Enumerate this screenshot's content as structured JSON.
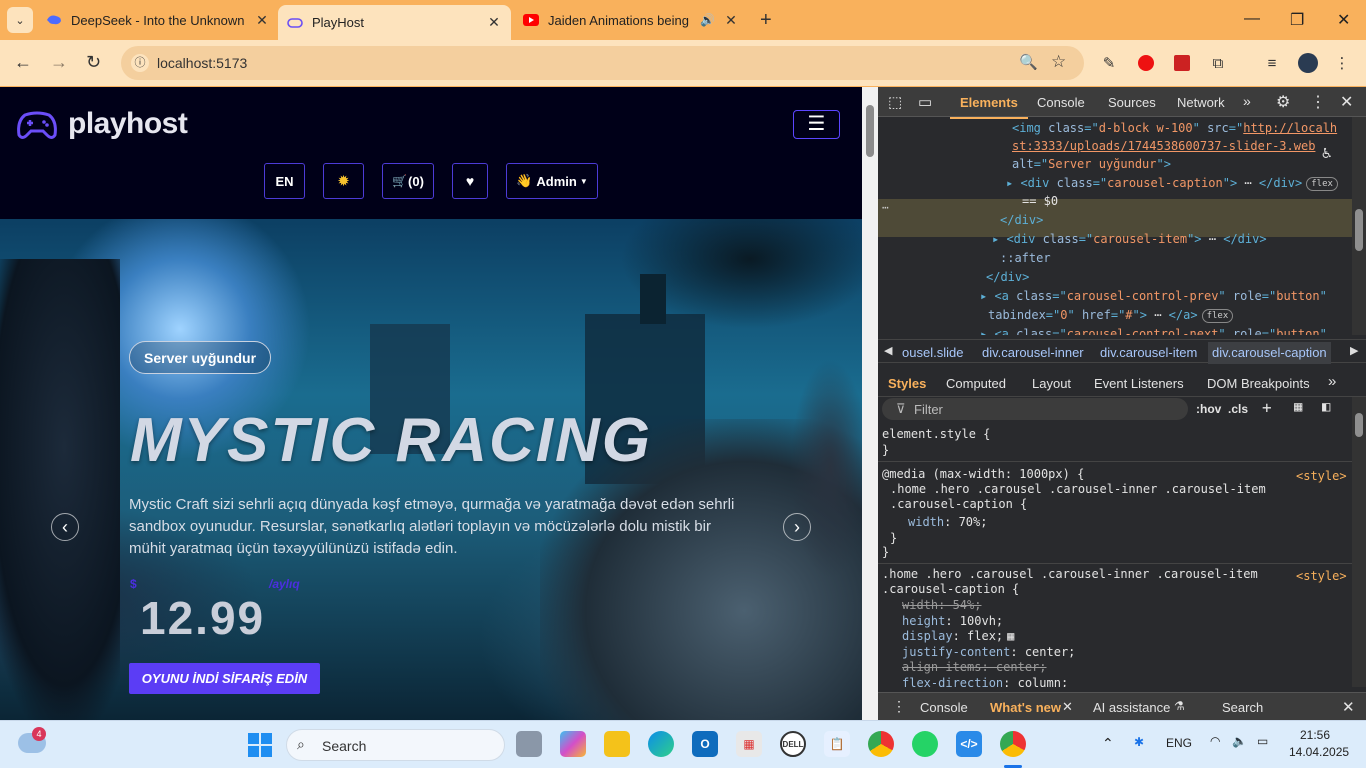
{
  "browser": {
    "tabs": [
      {
        "title": "DeepSeek - Into the Unknown",
        "icon": "deepseek-whale-icon",
        "active": false
      },
      {
        "title": "PlayHost",
        "icon": "gamepad-icon",
        "active": true
      },
      {
        "title": "Jaiden Animations being Jai",
        "icon": "youtube-icon",
        "active": false
      }
    ],
    "new_tab": "+",
    "url": "localhost:5173",
    "accent": "#f9b15c"
  },
  "site": {
    "logo": "playhost",
    "lang_button": "EN",
    "theme_icon": "sun-icon",
    "cart_label": "(0)",
    "wishlist_icon": "heart-icon",
    "admin_label": "Admin",
    "menu_icon": "hamburger-icon",
    "hero": {
      "badge": "Server uyğundur",
      "title": "MYSTIC RACING",
      "description": "Mystic Craft sizi sehrli açıq dünyada kəşf etməyə, qurmağa və yaratmağa dəvət edən sehrli sandbox oyunudur. Resurslar, sənətkarlıq alətləri toplayın və möcüzələrlə dolu mistik bir mühit yaratmaq üçün təxəyyülünüzü istifadə edin.",
      "currency": "$",
      "period": "/aylıq",
      "price": "12.99",
      "order_button": "OYUNU İNDİ SİFARİŞ EDİN",
      "prev_icon": "chevron-left-icon",
      "next_icon": "chevron-right-icon"
    },
    "brand_color": "#5b3df5"
  },
  "devtools": {
    "tabs": [
      "Elements",
      "Console",
      "Sources",
      "Network"
    ],
    "active_tab": "Elements",
    "code_lines": [
      {
        "indent": 134,
        "parts": [
          [
            "tagc",
            "<img "
          ],
          [
            "attr",
            "class"
          ],
          [
            "tagc",
            "=\""
          ],
          [
            "attv",
            "d-block w-100"
          ],
          [
            "tagc",
            "\" "
          ],
          [
            "attr",
            "src"
          ],
          [
            "tagc",
            "=\""
          ],
          [
            "link",
            "http://localh"
          ]
        ]
      },
      {
        "indent": 134,
        "parts": [
          [
            "link",
            "st:3333/uploads/1744538600737-slider-3.web"
          ]
        ]
      },
      {
        "indent": 134,
        "parts": [
          [
            "attr",
            "alt"
          ],
          [
            "tagc",
            "=\""
          ],
          [
            "attv",
            "Server uyğundur"
          ],
          [
            "tagc",
            "\">"
          ]
        ]
      },
      {
        "indent": 128,
        "parts": [
          [
            "tagc",
            "▸ <div "
          ],
          [
            "attr",
            "class"
          ],
          [
            "tagc",
            "=\""
          ],
          [
            "attv",
            "carousel-caption"
          ],
          [
            "tagc",
            "\">"
          ],
          [
            "plain",
            " ⋯ "
          ],
          [
            "tagc",
            "</div>"
          ]
        ],
        "pill": "flex"
      },
      {
        "indent": 144,
        "parts": [
          [
            "plain",
            "== $0"
          ]
        ]
      },
      {
        "indent": 122,
        "parts": [
          [
            "tagc",
            "</div>"
          ]
        ]
      },
      {
        "indent": 114,
        "parts": [
          [
            "tagc",
            "▸ <div "
          ],
          [
            "attr",
            "class"
          ],
          [
            "tagc",
            "=\""
          ],
          [
            "attv",
            "carousel-item"
          ],
          [
            "tagc",
            "\">"
          ],
          [
            "plain",
            " ⋯ "
          ],
          [
            "tagc",
            "</div>"
          ]
        ]
      },
      {
        "indent": 122,
        "parts": [
          [
            "attr",
            "::after"
          ]
        ]
      },
      {
        "indent": 108,
        "parts": [
          [
            "tagc",
            "</div>"
          ]
        ]
      },
      {
        "indent": 102,
        "parts": [
          [
            "tagc",
            "▸ <a "
          ],
          [
            "attr",
            "class"
          ],
          [
            "tagc",
            "=\""
          ],
          [
            "attv",
            "carousel-control-prev"
          ],
          [
            "tagc",
            "\" "
          ],
          [
            "attr",
            "role"
          ],
          [
            "tagc",
            "=\""
          ],
          [
            "attv",
            "button"
          ],
          [
            "tagc",
            "\""
          ]
        ]
      },
      {
        "indent": 110,
        "parts": [
          [
            "attr",
            "tabindex"
          ],
          [
            "tagc",
            "=\""
          ],
          [
            "attv",
            "0"
          ],
          [
            "tagc",
            "\" "
          ],
          [
            "attr",
            "href"
          ],
          [
            "tagc",
            "=\""
          ],
          [
            "attv",
            "#"
          ],
          [
            "tagc",
            "\">"
          ],
          [
            "plain",
            " ⋯ "
          ],
          [
            "tagc",
            "</a>"
          ]
        ],
        "pill": "flex"
      },
      {
        "indent": 102,
        "parts": [
          [
            "tagc",
            "▸ <a "
          ],
          [
            "attr",
            "class"
          ],
          [
            "tagc",
            "=\""
          ],
          [
            "attv",
            "carousel-control-next"
          ],
          [
            "tagc",
            "\" "
          ],
          [
            "attr",
            "role"
          ],
          [
            "tagc",
            "=\""
          ],
          [
            "attv",
            "button"
          ],
          [
            "tagc",
            "\""
          ]
        ]
      }
    ],
    "breadcrumbs": [
      "ousel.slide",
      "div.carousel-inner",
      "div.carousel-item",
      "div.carousel-caption"
    ],
    "style_tabs": [
      "Styles",
      "Computed",
      "Layout",
      "Event Listeners",
      "DOM Breakpoints"
    ],
    "filter_placeholder": "Filter",
    "filter_hov": ":hov",
    "filter_cls": ".cls",
    "rules": {
      "element_style": "element.style {",
      "close": "}",
      "media": "@media (max-width: 1000px) {",
      "media_selector_1": ".home .hero .carousel .carousel-inner .carousel-item",
      "media_selector_2": ".carousel-caption {",
      "media_prop": "width",
      "media_val": "70%;",
      "rule2_selector_1": ".home .hero .carousel .carousel-inner .carousel-item",
      "rule2_selector_2": ".carousel-caption {",
      "props": [
        {
          "name": "width",
          "value": "54%;",
          "struck": true
        },
        {
          "name": "height",
          "value": "100vh;",
          "struck": false
        },
        {
          "name": "display",
          "value": "flex;",
          "struck": false
        },
        {
          "name": "justify-content",
          "value": "center;",
          "struck": false
        },
        {
          "name": "align-items",
          "value": "center;",
          "struck": true
        },
        {
          "name": "flex-direction",
          "value": "column;",
          "struck": false
        }
      ],
      "source": "<style>"
    },
    "drawer_tabs": [
      "Console",
      "What's new",
      "AI assistance",
      "Search"
    ],
    "drawer_active": "What's new"
  },
  "taskbar": {
    "weather_badge": "4",
    "search_placeholder": "Search",
    "apps": [
      "task-view-icon",
      "copilot-icon",
      "file-explorer-icon",
      "edge-icon",
      "outlook-icon",
      "store-icon",
      "dell-icon",
      "notepad-icon",
      "chrome-icon",
      "whatsapp-icon",
      "vscode-icon",
      "chrome-active-icon"
    ],
    "language": "ENG",
    "time": "21:56",
    "date": "14.04.2025"
  }
}
